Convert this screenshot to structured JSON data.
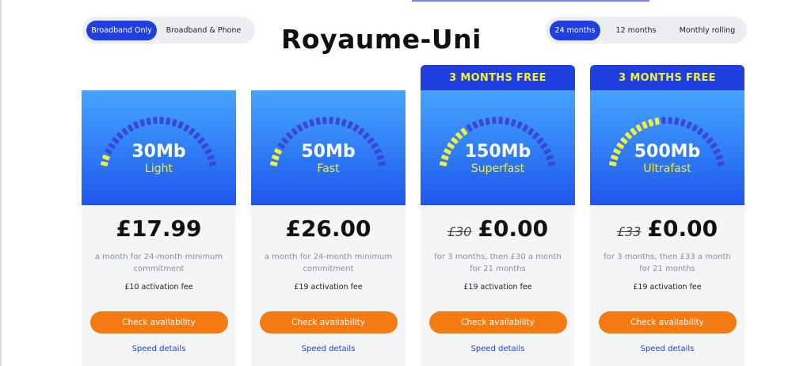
{
  "title": "Royaume-Uni",
  "product_filter": {
    "options": [
      "Broadband Only",
      "Broadband & Phone"
    ],
    "selected": "Broadband Only"
  },
  "contract_filter": {
    "options": [
      "24 months",
      "12 months",
      "Monthly rolling"
    ],
    "selected": "24 months"
  },
  "colors": {
    "brand_blue": "#1f3fe0",
    "accent_yellow": "#f2f03a",
    "cta_orange": "#f47a12",
    "gauge_track": "#3a48d6"
  },
  "plans": [
    {
      "speed": "30Mb",
      "tier": "Light",
      "promo": "",
      "old_price": "",
      "price": "£17.99",
      "description": "a month for 24-month minimum commitment",
      "activation_fee": "£10 activation fee",
      "cta_label": "Check availability",
      "details_label": "Speed details",
      "gauge_fill": 0.08
    },
    {
      "speed": "50Mb",
      "tier": "Fast",
      "promo": "",
      "old_price": "",
      "price": "£26.00",
      "description": "a month for 24-month minimum commitment",
      "activation_fee": "£19 activation fee",
      "cta_label": "Check availability",
      "details_label": "Speed details",
      "gauge_fill": 0.12
    },
    {
      "speed": "150Mb",
      "tier": "Superfast",
      "promo": "3 MONTHS FREE",
      "old_price": "£30",
      "price": "£0.00",
      "description": "for 3 months, then £30 a month for 21 months",
      "activation_fee": "£19 activation fee",
      "cta_label": "Check availability",
      "details_label": "Speed details",
      "gauge_fill": 0.3
    },
    {
      "speed": "500Mb",
      "tier": "Ultrafast",
      "promo": "3 MONTHS FREE",
      "old_price": "£33",
      "price": "£0.00",
      "description": "for 3 months, then £33 a month for 21 months",
      "activation_fee": "£19 activation fee",
      "cta_label": "Check availability",
      "details_label": "Speed details",
      "gauge_fill": 0.45
    }
  ]
}
